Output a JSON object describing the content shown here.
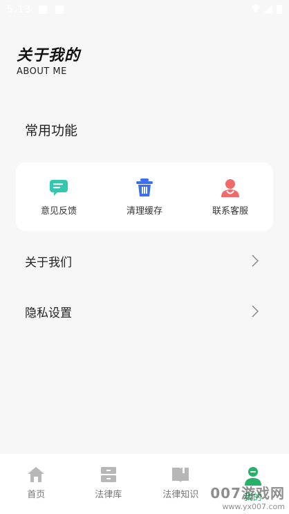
{
  "status_bar": {
    "time": "5:13"
  },
  "header": {
    "title": "关于我的",
    "subtitle": "ABOUT ME"
  },
  "section": {
    "title": "常用功能"
  },
  "functions": [
    {
      "label": "意见反馈",
      "icon": "feedback-chat-icon",
      "color": "#33c7b0"
    },
    {
      "label": "清理缓存",
      "icon": "clear-cache-trash-icon",
      "color": "#3b6ff0"
    },
    {
      "label": "联系客服",
      "icon": "customer-service-icon",
      "color": "#f06a6a"
    }
  ],
  "menu": [
    {
      "label": "关于我们"
    },
    {
      "label": "隐私设置"
    }
  ],
  "tabs": [
    {
      "label": "首页",
      "icon": "home-icon",
      "active": false
    },
    {
      "label": "法律库",
      "icon": "cabinet-icon",
      "active": false
    },
    {
      "label": "法律知识",
      "icon": "book-icon",
      "active": false
    },
    {
      "label": "我的",
      "icon": "user-icon",
      "active": true
    }
  ],
  "watermark": {
    "text": "007游戏网",
    "url": "www.yx007.com"
  },
  "colors": {
    "accent": "#26b06a",
    "background": "#f7f7f7",
    "inactive": "#b7b7b7"
  }
}
